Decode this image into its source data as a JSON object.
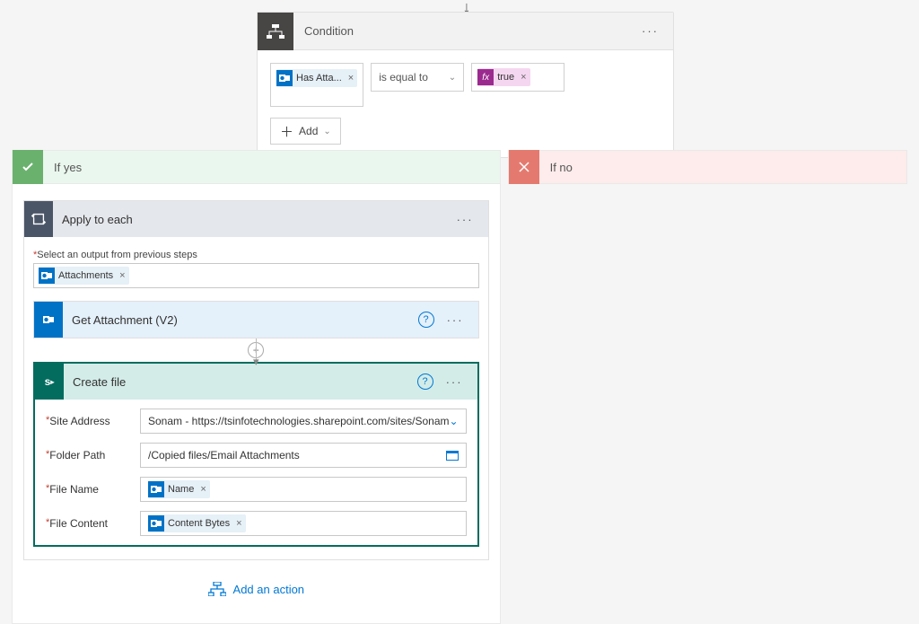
{
  "condition": {
    "title": "Condition",
    "left_token": "Has Atta...",
    "operator": "is equal to",
    "right_token": "true",
    "add_button": "Add"
  },
  "branches": {
    "yes_title": "If yes",
    "no_title": "If no"
  },
  "apply_each": {
    "title": "Apply to each",
    "select_label": "Select an output from previous steps",
    "attachments_token": "Attachments"
  },
  "get_attachment": {
    "title": "Get Attachment (V2)"
  },
  "create_file": {
    "title": "Create file",
    "fields": {
      "site_address": {
        "label": "Site Address",
        "value": "Sonam - https://tsinfotechnologies.sharepoint.com/sites/Sonam"
      },
      "folder_path": {
        "label": "Folder Path",
        "value": "/Copied files/Email Attachments"
      },
      "file_name": {
        "label": "File Name",
        "token": "Name"
      },
      "file_content": {
        "label": "File Content",
        "token": "Content Bytes"
      }
    }
  },
  "add_action": "Add an action"
}
